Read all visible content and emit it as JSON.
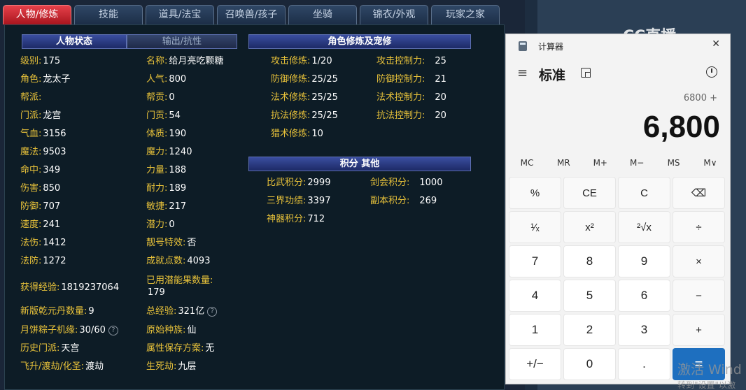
{
  "tabs": [
    "人物/修炼",
    "技能",
    "道具/法宝",
    "召唤兽/孩子",
    "坐骑",
    "锦衣/外观",
    "玩家之家"
  ],
  "sections": {
    "status": "人物状态",
    "output": "输出/抗性",
    "cultivation": "角色修炼及宠修",
    "points": "积分 其他"
  },
  "left_col": [
    {
      "label": "级别:",
      "value": "175"
    },
    {
      "label": "角色:",
      "value": "龙太子"
    },
    {
      "label": "帮派:",
      "value": ""
    },
    {
      "label": "门派:",
      "value": "龙宫"
    },
    {
      "label": "气血:",
      "value": "3156"
    },
    {
      "label": "魔法:",
      "value": "9503"
    },
    {
      "label": "命中:",
      "value": "349"
    },
    {
      "label": "伤害:",
      "value": "850"
    },
    {
      "label": "防御:",
      "value": "707"
    },
    {
      "label": "速度:",
      "value": "241"
    },
    {
      "label": "法伤:",
      "value": "1412"
    },
    {
      "label": "法防:",
      "value": "1272"
    }
  ],
  "mid_col": [
    {
      "label": "名称:",
      "value": "给月亮吃颗糖"
    },
    {
      "label": "人气:",
      "value": "800"
    },
    {
      "label": "帮贡:",
      "value": "0"
    },
    {
      "label": "门贡:",
      "value": "54"
    },
    {
      "label": "体质:",
      "value": "190"
    },
    {
      "label": "魔力:",
      "value": "1240"
    },
    {
      "label": "力量:",
      "value": "188"
    },
    {
      "label": "耐力:",
      "value": "189"
    },
    {
      "label": "敏捷:",
      "value": "217"
    },
    {
      "label": "潜力:",
      "value": "0"
    },
    {
      "label": "靓号特效:",
      "value": "否"
    },
    {
      "label": "成就点数:",
      "value": "4093"
    }
  ],
  "bottom_left": [
    {
      "label": "获得经验:",
      "value": "1819237064"
    },
    {
      "label": "新版乾元丹数量:",
      "value": "9"
    },
    {
      "label": "月饼粽子机缘:",
      "value": "30/60"
    },
    {
      "label": "历史门派:",
      "value": "天宫"
    },
    {
      "label": "飞升/渡劫/化圣:",
      "value": "渡劫"
    }
  ],
  "bottom_mid": [
    {
      "label": "已用潜能果数量:",
      "value": "179"
    },
    {
      "label": "总经验:",
      "value": "321亿"
    },
    {
      "label": "原始种族:",
      "value": "仙"
    },
    {
      "label": "属性保存方案:",
      "value": "无"
    },
    {
      "label": "生死劫:",
      "value": "九层"
    }
  ],
  "cultivation": [
    {
      "label": "攻击修炼:",
      "value": "1/20",
      "label2": "攻击控制力:",
      "value2": "25"
    },
    {
      "label": "防御修炼:",
      "value": "25/25",
      "label2": "防御控制力:",
      "value2": "21"
    },
    {
      "label": "法术修炼:",
      "value": "25/25",
      "label2": "法术控制力:",
      "value2": "20"
    },
    {
      "label": "抗法修炼:",
      "value": "25/25",
      "label2": "抗法控制力:",
      "value2": "20"
    },
    {
      "label": "猎术修炼:",
      "value": "10",
      "label2": "",
      "value2": ""
    }
  ],
  "points": [
    {
      "label": "比武积分:",
      "value": "2999",
      "label2": "剑会积分:",
      "value2": "1000"
    },
    {
      "label": "三界功绩:",
      "value": "3397",
      "label2": "副本积分:",
      "value2": "269"
    },
    {
      "label": "神器积分:",
      "value": "712",
      "label2": "",
      "value2": ""
    }
  ],
  "help_icon": "?",
  "watermark": "CC直播",
  "calculator": {
    "title": "计算器",
    "mode": "标准",
    "menu_icon": "≡",
    "close_icon": "✕",
    "expression": "6800 +",
    "display": "6,800",
    "memory": [
      "MC",
      "MR",
      "M+",
      "M−",
      "MS",
      "M∨"
    ],
    "keys": [
      "%",
      "CE",
      "C",
      "⌫",
      "¹⁄ₓ",
      "x²",
      "²√x",
      "÷",
      "7",
      "8",
      "9",
      "×",
      "4",
      "5",
      "6",
      "−",
      "1",
      "2",
      "3",
      "+",
      "+/−",
      "0",
      ".",
      "="
    ]
  },
  "activation": {
    "line1": "激活 Wind",
    "line2": "转到\"设置\"以激"
  }
}
